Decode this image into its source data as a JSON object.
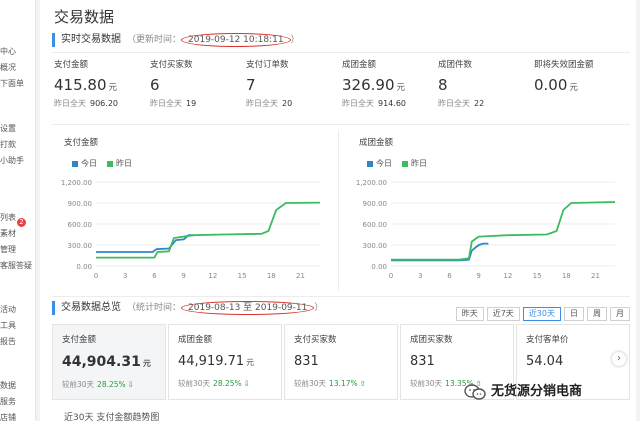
{
  "sidebar": {
    "items": [
      "中心",
      "概况",
      "下面单",
      "设置",
      "打款",
      "小助手",
      "列表",
      "素材",
      "管理",
      "客服答疑",
      "活动",
      "工具",
      "报告",
      "数据",
      "服务",
      "店铺"
    ],
    "badge": "2"
  },
  "page_title": "交易数据",
  "realtime": {
    "title": "实时交易数据",
    "update_label": "（更新时间：",
    "update_time": "2019-09-12 10:18:11",
    "update_suffix": "）"
  },
  "stats": [
    {
      "label": "支付金额",
      "value": "415.80",
      "unit": "元",
      "yday_label": "昨日全天",
      "yday_value": "906.20"
    },
    {
      "label": "支付买家数",
      "value": "6",
      "unit": "",
      "yday_label": "昨日全天",
      "yday_value": "19"
    },
    {
      "label": "支付订单数",
      "value": "7",
      "unit": "",
      "yday_label": "昨日全天",
      "yday_value": "20"
    },
    {
      "label": "成团金额",
      "value": "326.90",
      "unit": "元",
      "yday_label": "昨日全天",
      "yday_value": "914.60"
    },
    {
      "label": "成团件数",
      "value": "8",
      "unit": "",
      "yday_label": "昨日全天",
      "yday_value": "22"
    },
    {
      "label": "即将失效团金额",
      "value": "0.00",
      "unit": "元",
      "yday_label": "",
      "yday_value": ""
    }
  ],
  "legend": {
    "today": "今日",
    "yesterday": "昨日"
  },
  "colors": {
    "today": "#2e86c9",
    "yesterday": "#3dbb61",
    "accent": "#3a8ee6",
    "circle": "#d9342b"
  },
  "chart_data": [
    {
      "type": "line",
      "title": "支付金额",
      "x_ticks": [
        0,
        3,
        6,
        9,
        12,
        15,
        18,
        21
      ],
      "y_ticks": [
        "0.00",
        "300.00",
        "600.00",
        "900.00",
        "1,200.00"
      ],
      "ylim": [
        0,
        1200
      ],
      "xlim": [
        0,
        23
      ],
      "series": [
        {
          "name": "今日",
          "points": [
            [
              0,
              200
            ],
            [
              5.8,
              200
            ],
            [
              6.2,
              240
            ],
            [
              7.5,
              250
            ],
            [
              8.2,
              370
            ],
            [
              9,
              380
            ],
            [
              9.5,
              440
            ],
            [
              10,
              440
            ]
          ]
        },
        {
          "name": "昨日",
          "points": [
            [
              0,
              120
            ],
            [
              6,
              120
            ],
            [
              6.3,
              200
            ],
            [
              7.5,
              210
            ],
            [
              8,
              400
            ],
            [
              10,
              440
            ],
            [
              13,
              450
            ],
            [
              17,
              460
            ],
            [
              17.7,
              500
            ],
            [
              18.5,
              800
            ],
            [
              19.5,
              900
            ],
            [
              23,
              906
            ]
          ]
        }
      ]
    },
    {
      "type": "line",
      "title": "成团金额",
      "x_ticks": [
        0,
        3,
        6,
        9,
        12,
        15,
        18,
        21
      ],
      "y_ticks": [
        "0.00",
        "300.00",
        "600.00",
        "900.00",
        "1,200.00"
      ],
      "ylim": [
        0,
        1200
      ],
      "xlim": [
        0,
        23
      ],
      "series": [
        {
          "name": "今日",
          "points": [
            [
              0,
              80
            ],
            [
              7,
              80
            ],
            [
              8,
              90
            ],
            [
              8.3,
              220
            ],
            [
              9,
              300
            ],
            [
              9.5,
              320
            ],
            [
              10,
              320
            ]
          ]
        },
        {
          "name": "昨日",
          "points": [
            [
              0,
              90
            ],
            [
              7,
              90
            ],
            [
              8,
              110
            ],
            [
              8.3,
              350
            ],
            [
              9,
              420
            ],
            [
              12,
              440
            ],
            [
              16,
              450
            ],
            [
              17,
              500
            ],
            [
              17.7,
              800
            ],
            [
              18.5,
              900
            ],
            [
              23,
              914
            ]
          ]
        }
      ]
    }
  ],
  "overview": {
    "title": "交易数据总览",
    "range_label": "（统计时间：",
    "range_value": "2019-08-13 至 2019-09-11",
    "range_suffix": "）",
    "periods": [
      "昨天",
      "近7天",
      "近30天",
      "日",
      "周",
      "月"
    ],
    "active_period": "近30天"
  },
  "cards": [
    {
      "label": "支付金额",
      "value": "44,904.31",
      "unit": "元",
      "cmp_label": "较前30天",
      "cmp_pct": "28.25%",
      "arrow": "⇩"
    },
    {
      "label": "成团金额",
      "value": "44,919.71",
      "unit": "元",
      "cmp_label": "较前30天",
      "cmp_pct": "28.25%",
      "arrow": "⇩"
    },
    {
      "label": "支付买家数",
      "value": "831",
      "unit": "",
      "cmp_label": "较前30天",
      "cmp_pct": "13.17%",
      "arrow": "⇧"
    },
    {
      "label": "成团买家数",
      "value": "831",
      "unit": "",
      "cmp_label": "较前30天",
      "cmp_pct": "13.35%",
      "arrow": "⇧"
    },
    {
      "label": "支付客单价",
      "value": "54.04",
      "unit": "",
      "cmp_label": "",
      "cmp_pct": "",
      "arrow": ""
    }
  ],
  "bottom_text": "近30天 支付金额趋势图",
  "watermark": "无货源分销电商"
}
